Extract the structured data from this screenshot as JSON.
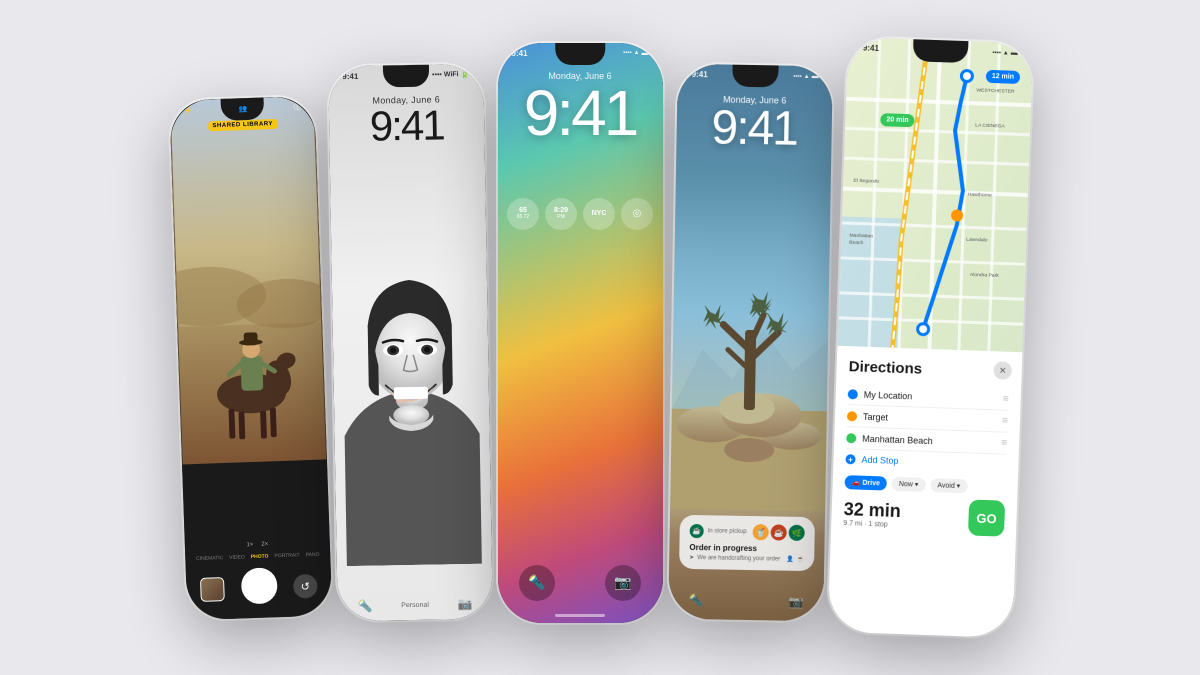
{
  "background_color": "#e8e8ed",
  "phones": [
    {
      "id": "phone1",
      "type": "camera",
      "shared_library_badge": "SHARED LIBRARY",
      "camera_modes": [
        "CINEMATIC",
        "VIDEO",
        "PHOTO",
        "PORTRAIT",
        "PANO"
      ],
      "active_mode": "PHOTO"
    },
    {
      "id": "phone2",
      "type": "lockscreen_bw",
      "day": "Monday, June 6",
      "time": "9:41",
      "bottom_label": "Personal"
    },
    {
      "id": "phone3",
      "type": "lockscreen_color",
      "day": "Monday, June 6",
      "time": "9:41",
      "widgets": [
        "65\n65 72",
        "8:29\nPM",
        "NYC"
      ],
      "status_time": "9:41"
    },
    {
      "id": "phone4",
      "type": "lockscreen_nature",
      "day": "Monday, June 6",
      "time": "9:41",
      "notification": {
        "store_label": "In store pickup",
        "title": "Order in progress",
        "subtitle": "We are handcrafting your order"
      }
    },
    {
      "id": "phone5",
      "type": "maps",
      "status_time": "9:41",
      "map_time_badge": "12 min",
      "map_min_badge": "20 min",
      "directions": {
        "title": "Directions",
        "stops": [
          {
            "label": "My Location",
            "type": "blue"
          },
          {
            "label": "Target",
            "type": "orange"
          },
          {
            "label": "Manhattan Beach",
            "type": "green"
          }
        ],
        "add_stop": "Add Stop",
        "travel_mode": "Drive",
        "now_label": "Now ▾",
        "avoid_label": "Avoid ▾",
        "route_time": "32 min",
        "route_detail": "9.7 mi · 1 stop",
        "go_label": "GO"
      }
    }
  ]
}
